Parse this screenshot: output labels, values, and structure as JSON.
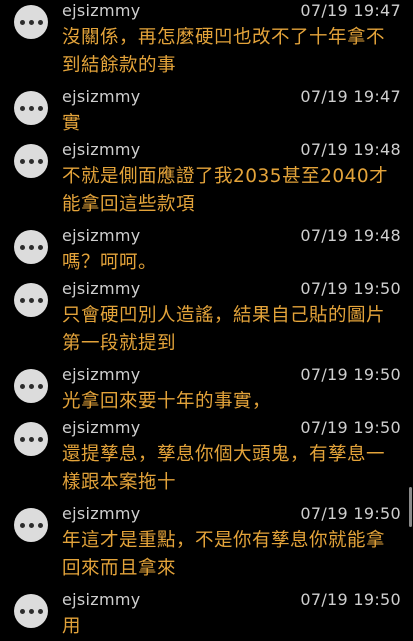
{
  "comments": [
    {
      "user": "ejsizmmy",
      "time": "07/19 19:47",
      "text": "沒關係，再怎麼硬凹也改不了十年拿不到結餘款的事"
    },
    {
      "user": "ejsizmmy",
      "time": "07/19 19:47",
      "text": "實"
    },
    {
      "user": "ejsizmmy",
      "time": "07/19 19:48",
      "text": "不就是側面應證了我2035甚至2040才能拿回這些款項"
    },
    {
      "user": "ejsizmmy",
      "time": "07/19 19:48",
      "text": "嗎？呵呵。"
    },
    {
      "user": "ejsizmmy",
      "time": "07/19 19:50",
      "text": "只會硬凹別人造謠，結果自己貼的圖片第一段就提到"
    },
    {
      "user": "ejsizmmy",
      "time": "07/19 19:50",
      "text": "光拿回來要十年的事實，"
    },
    {
      "user": "ejsizmmy",
      "time": "07/19 19:50",
      "text": "還提孳息，孳息你個大頭鬼，有孳息一樣跟本案拖十"
    },
    {
      "user": "ejsizmmy",
      "time": "07/19 19:50",
      "text": "年這才是重點，不是你有孳息你就能拿回來而且拿來"
    },
    {
      "user": "ejsizmmy",
      "time": "07/19 19:50",
      "text": "用"
    }
  ],
  "colors": {
    "background": "#000000",
    "meta_text": "#cfcfcf",
    "message_text": "#e3a33a",
    "avatar": "#dcdcdc"
  },
  "icons": {
    "avatar": "chat-bubble-dots-icon"
  }
}
